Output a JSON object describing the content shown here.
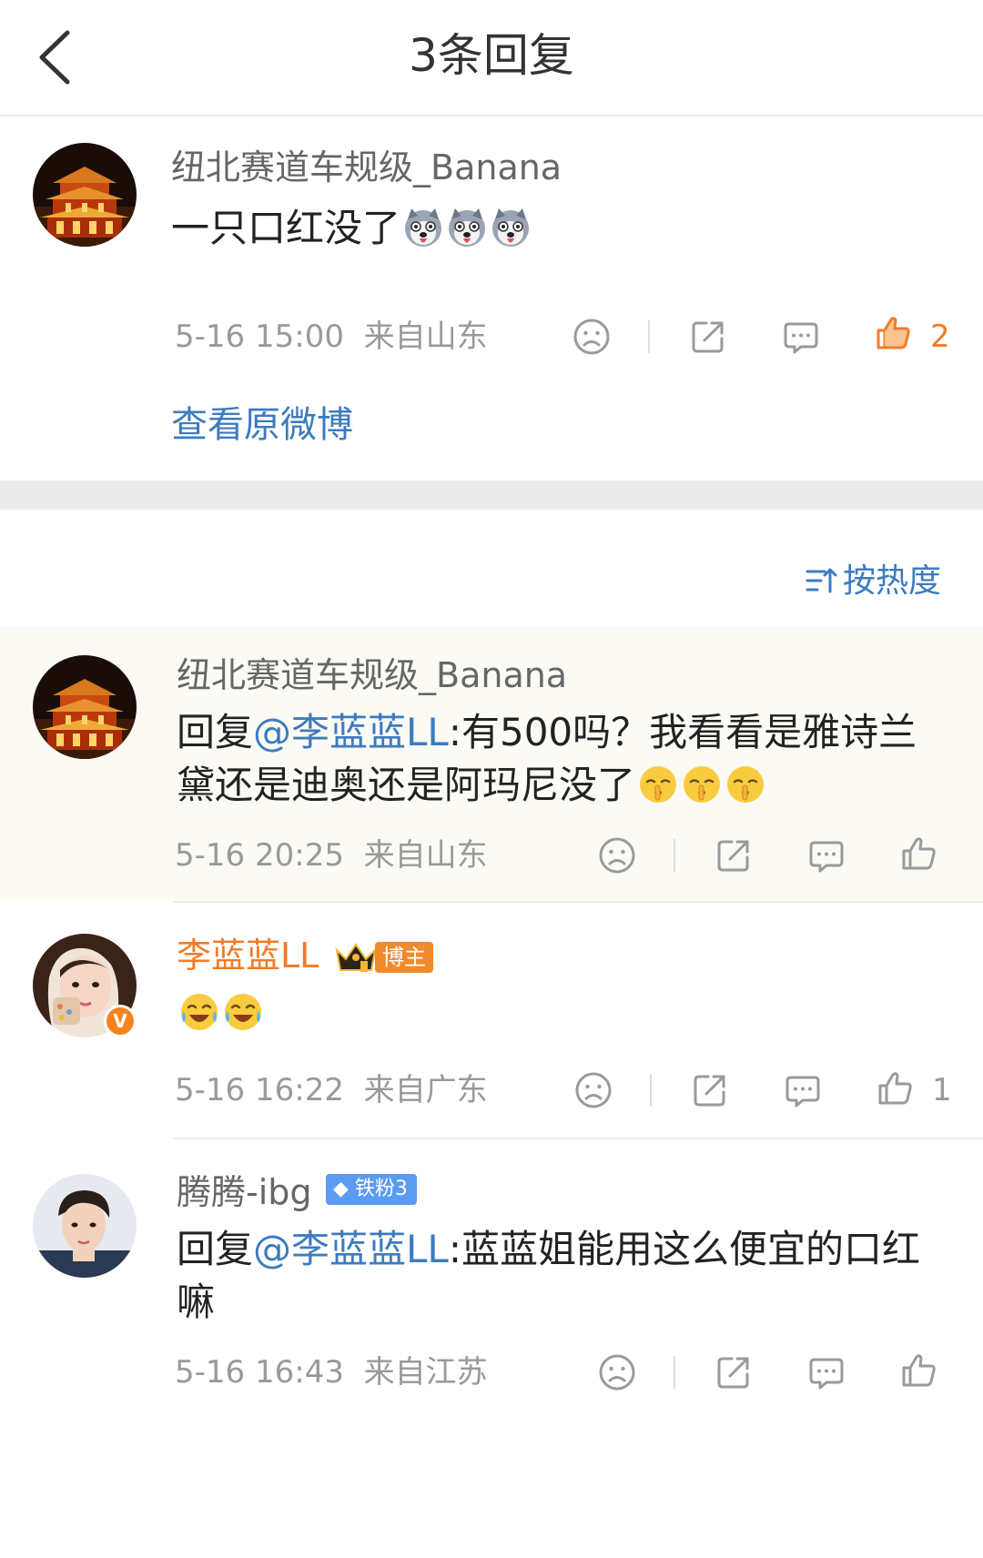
{
  "header": {
    "title": "3条回复"
  },
  "main_comment": {
    "username": "纽北赛道车规级_Banana",
    "text": "一只口红没了",
    "emojis": [
      "husky-emoji",
      "husky-emoji",
      "husky-emoji"
    ],
    "time": "5-16 15:00",
    "location": "来自山东",
    "like_count": "2",
    "view_original": "查看原微博"
  },
  "sort": {
    "label": "按热度"
  },
  "replies": [
    {
      "username": "纽北赛道车规级_Banana",
      "reply_prefix": "回复",
      "mention": "@李蓝蓝LL",
      "text": ":有500吗？我看看是雅诗兰黛还是迪奥还是阿玛尼没了",
      "emojis": [
        "shush-emoji",
        "shush-emoji",
        "shush-emoji"
      ],
      "time": "5-16 20:25",
      "location": "来自山东"
    },
    {
      "username": "李蓝蓝LL",
      "host_badge": "博主",
      "verified_mark": "V",
      "emojis": [
        "laugh-cry-emoji",
        "laugh-cry-emoji"
      ],
      "time": "5-16 16:22",
      "location": "来自广东",
      "like_count": "1"
    },
    {
      "username": "腾腾-ibg",
      "fan_badge": "铁粉3",
      "reply_prefix": "回复",
      "mention": "@李蓝蓝LL",
      "text": ":蓝蓝姐能用这么便宜的口红嘛",
      "time": "5-16 16:43",
      "location": "来自江苏"
    }
  ],
  "colors": {
    "link": "#3d7bbf",
    "like_active": "#f07c2a",
    "host_badge": "#f08a2c",
    "fan_badge": "#5b9cf2"
  }
}
